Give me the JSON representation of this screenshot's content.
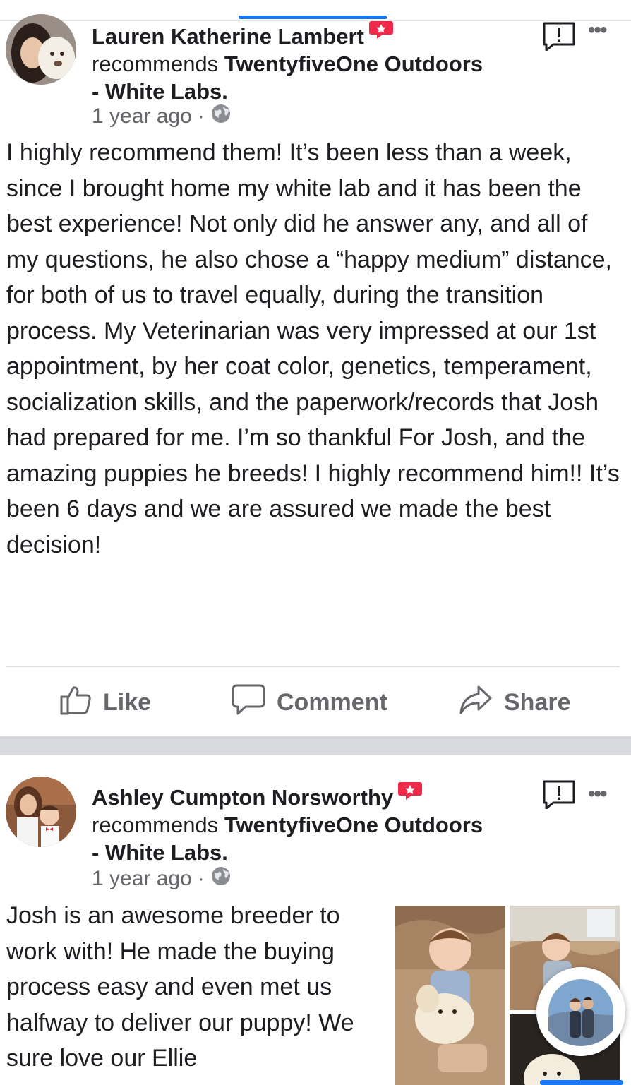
{
  "colors": {
    "primary_text": "#1c1e21",
    "secondary_text": "#65676b",
    "accent_blue": "#1877f2",
    "recommend_red": "#f02849",
    "separator": "#d9dadf"
  },
  "posts": [
    {
      "author": "Lauren Katherine Lambert",
      "recommends_text": "recommends",
      "page_name_line1": "TwentyfiveOne Outdoors",
      "page_name_line2": "- White Labs.",
      "time": "1 year ago",
      "dot": "·",
      "body": "I highly recommend them! It’s been less than a week, since I brought home my white lab and it has been the best experience! Not only did he answer any, and all of my questions, he also chose a “happy medium” distance, for both of us to travel equally, during the transition process. My Veterinarian was very impressed at our 1st appointment, by her coat color, genetics, temperament, socialization skills, and the paperwork/records that Josh had prepared for me. I’m so thankful For Josh, and the amazing puppies he breeds! I highly recommend him!! It’s been 6 days and we are assured we made the best decision!",
      "actions": {
        "like": "Like",
        "comment": "Comment",
        "share": "Share"
      }
    },
    {
      "author": "Ashley Cumpton Norsworthy",
      "recommends_text": "recommends",
      "page_name_line1": "TwentyfiveOne Outdoors",
      "page_name_line2": "- White Labs.",
      "time": "1 year ago",
      "dot": "·",
      "body": "Josh is an awesome breeder to work with! He made the buying process easy and even met us halfway to deliver our puppy! We sure love our Ellie"
    }
  ],
  "icons": {
    "report": "report-flag-icon",
    "more": "more-options-icon",
    "globe": "globe-icon",
    "recommend": "recommend-badge-icon",
    "like": "thumbs-up-icon",
    "comment": "comment-bubble-icon",
    "share": "share-arrow-icon"
  },
  "more_glyph": "•••",
  "report_glyph": "!"
}
